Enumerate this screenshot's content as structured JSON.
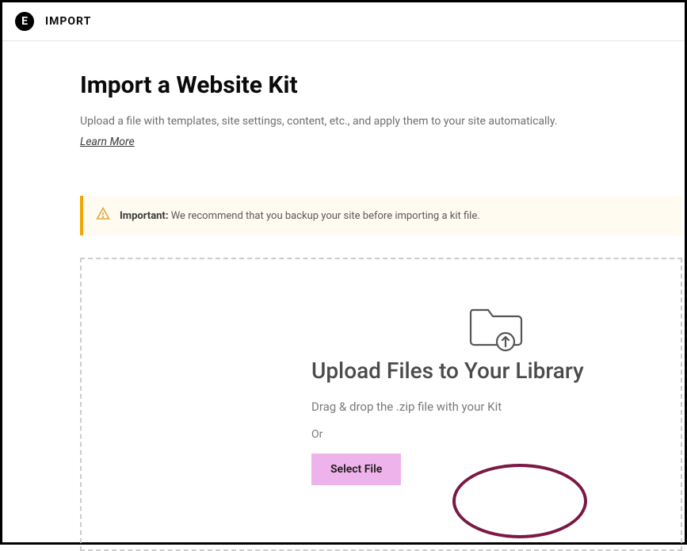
{
  "header": {
    "title": "IMPORT"
  },
  "page": {
    "title": "Import a Website Kit",
    "description": "Upload a file with templates, site settings, content, etc., and apply them to your site automatically.",
    "learn_more": "Learn More"
  },
  "alert": {
    "label": "Important:",
    "message": " We recommend that you backup your site before importing a kit file."
  },
  "dropzone": {
    "title": "Upload Files to Your Library",
    "subtitle": "Drag & drop the .zip file with your Kit",
    "or": "Or",
    "button": "Select File"
  }
}
